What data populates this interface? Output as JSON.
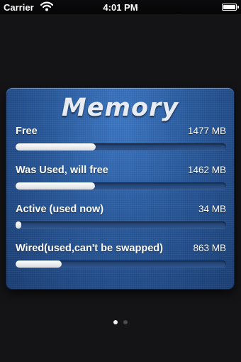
{
  "status_bar": {
    "carrier": "Carrier",
    "time": "4:01 PM",
    "battery_level": 1.0
  },
  "panel": {
    "title": "Memory",
    "rows": [
      {
        "label": "Free",
        "value": "1477 MB",
        "fraction": 0.38
      },
      {
        "label": "Was Used, will free",
        "value": "1462 MB",
        "fraction": 0.378
      },
      {
        "label": "Active (used now)",
        "value": "34 MB",
        "fraction": 0.01
      },
      {
        "label": "Wired(used,can't be swapped)",
        "value": "863 MB",
        "fraction": 0.22
      }
    ]
  },
  "page_indicator": {
    "pages": 2,
    "current": 1
  },
  "colors": {
    "background": "#141417",
    "panel_blue": "#2a5a9c",
    "bar_fill": "#ffffff"
  }
}
